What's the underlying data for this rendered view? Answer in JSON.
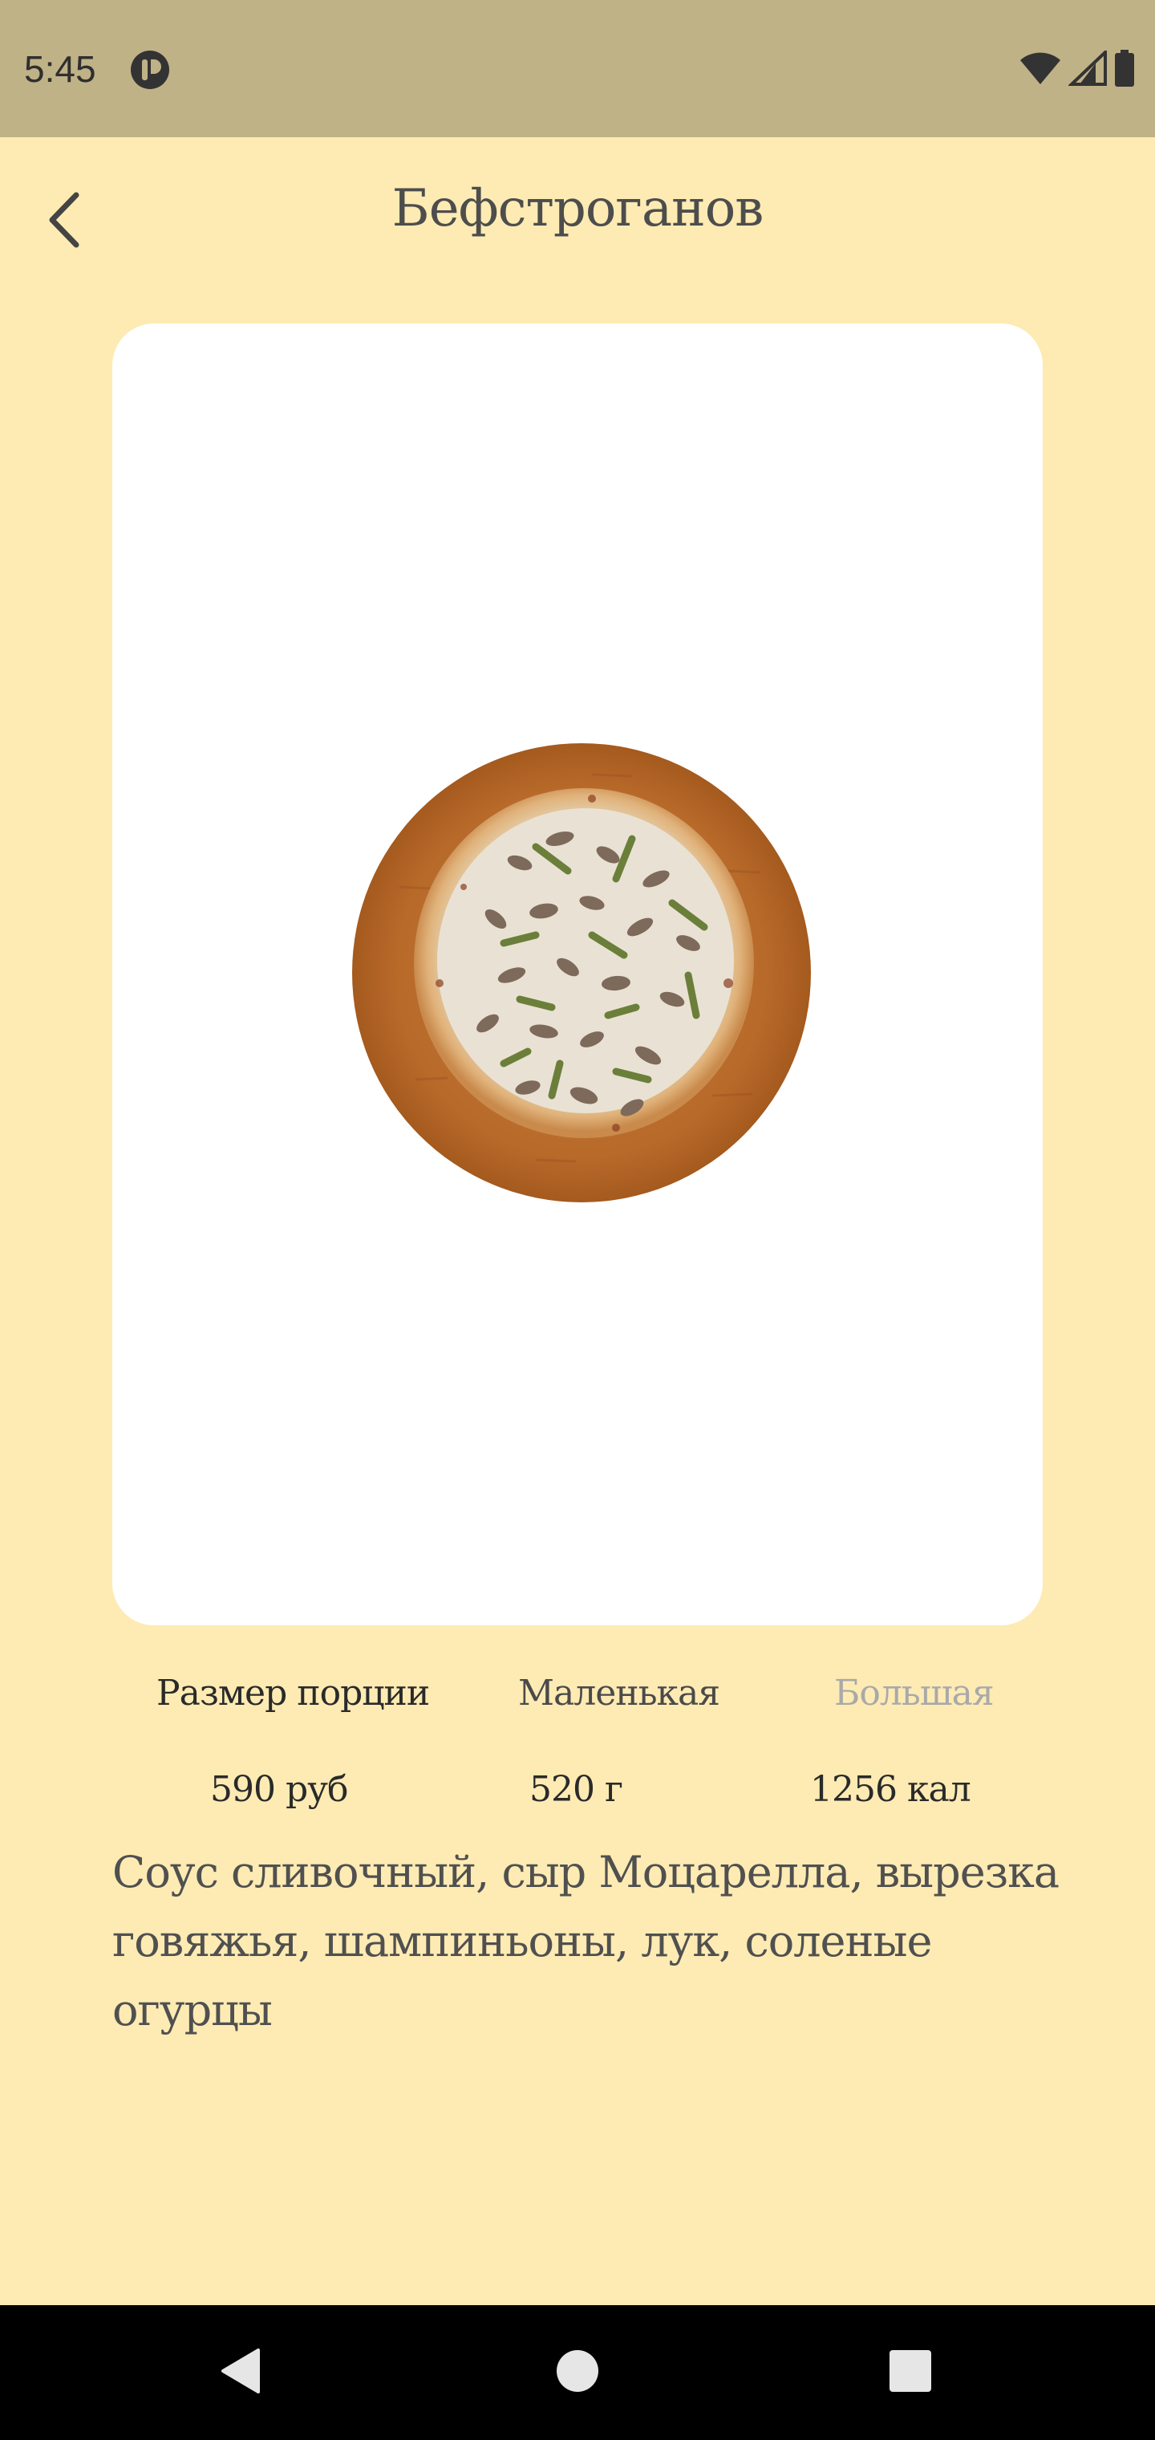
{
  "status_bar": {
    "time": "5:45",
    "icons": [
      "app-notification-icon",
      "wifi-icon",
      "cellular-signal-icon",
      "battery-icon"
    ],
    "background": "#c0b287"
  },
  "header": {
    "title": "Бефстроганов",
    "back_icon": "chevron-left-icon"
  },
  "product": {
    "image": "pizza-photo",
    "portion_label": "Размер порции",
    "portion_options": [
      {
        "label": "Маленькая",
        "selected": true
      },
      {
        "label": "Большая",
        "selected": false
      }
    ],
    "price": "590 руб",
    "weight": "520 г",
    "calories": "1256 кал",
    "description": "Соус сливочный, сыр Моцарелла, вырезка говяжья, шампиньоны, лук, соленые огурцы"
  },
  "nav_bar": {
    "buttons": [
      "back-triangle-icon",
      "home-circle-icon",
      "recents-square-icon"
    ]
  },
  "colors": {
    "page_background": "#fdebb3",
    "card_background": "#ffffff",
    "unselected_option": "#a9a9a9"
  }
}
